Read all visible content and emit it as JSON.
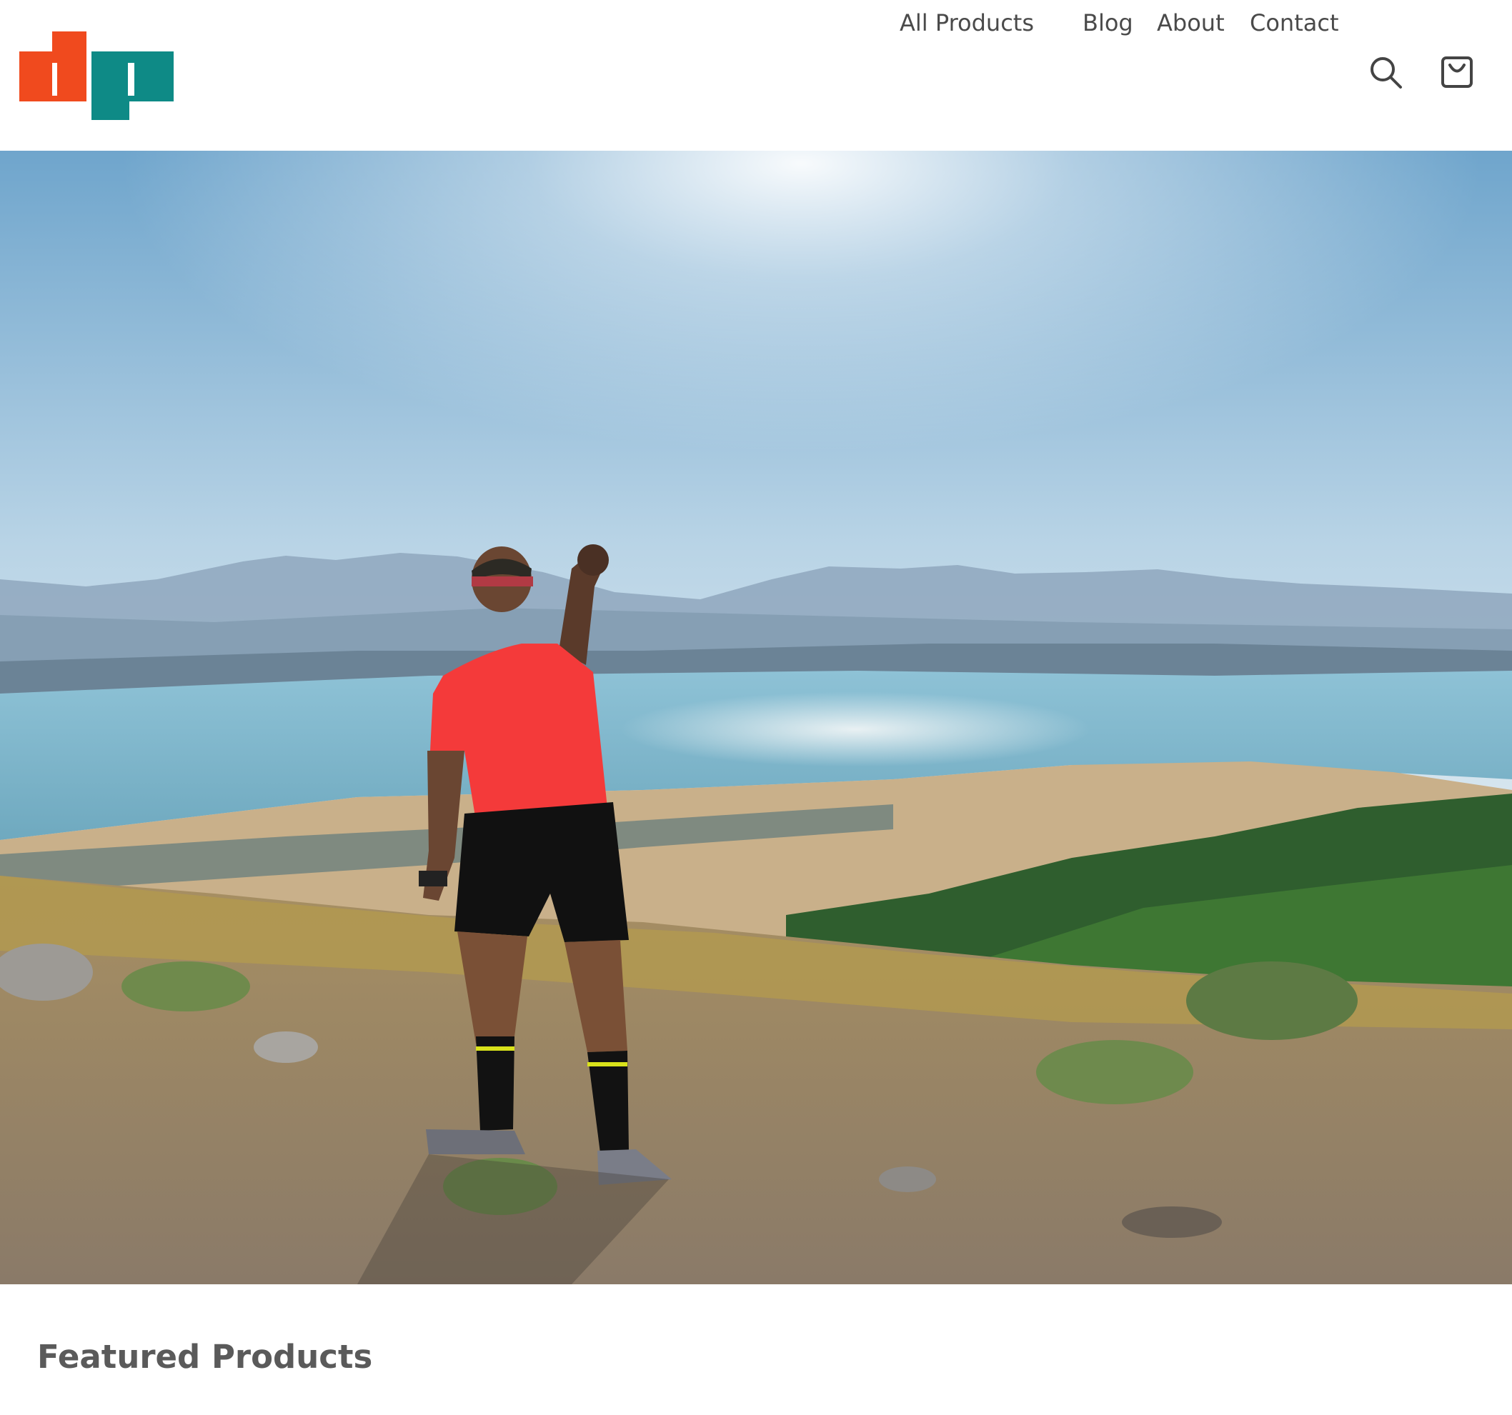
{
  "brand": {
    "logo_letters": "dp",
    "colors": {
      "orange": "#f04a1e",
      "teal": "#0e8a86"
    }
  },
  "nav": {
    "items": [
      {
        "label": "All Products"
      },
      {
        "label": "Blog"
      },
      {
        "label": "About"
      },
      {
        "label": "Contact"
      }
    ],
    "search_icon": "search-icon",
    "cart_icon": "shopping-bag-icon"
  },
  "hero": {
    "image": "hiker-raising-fist-on-mountain-above-lake"
  },
  "featured": {
    "heading": "Featured Products"
  }
}
